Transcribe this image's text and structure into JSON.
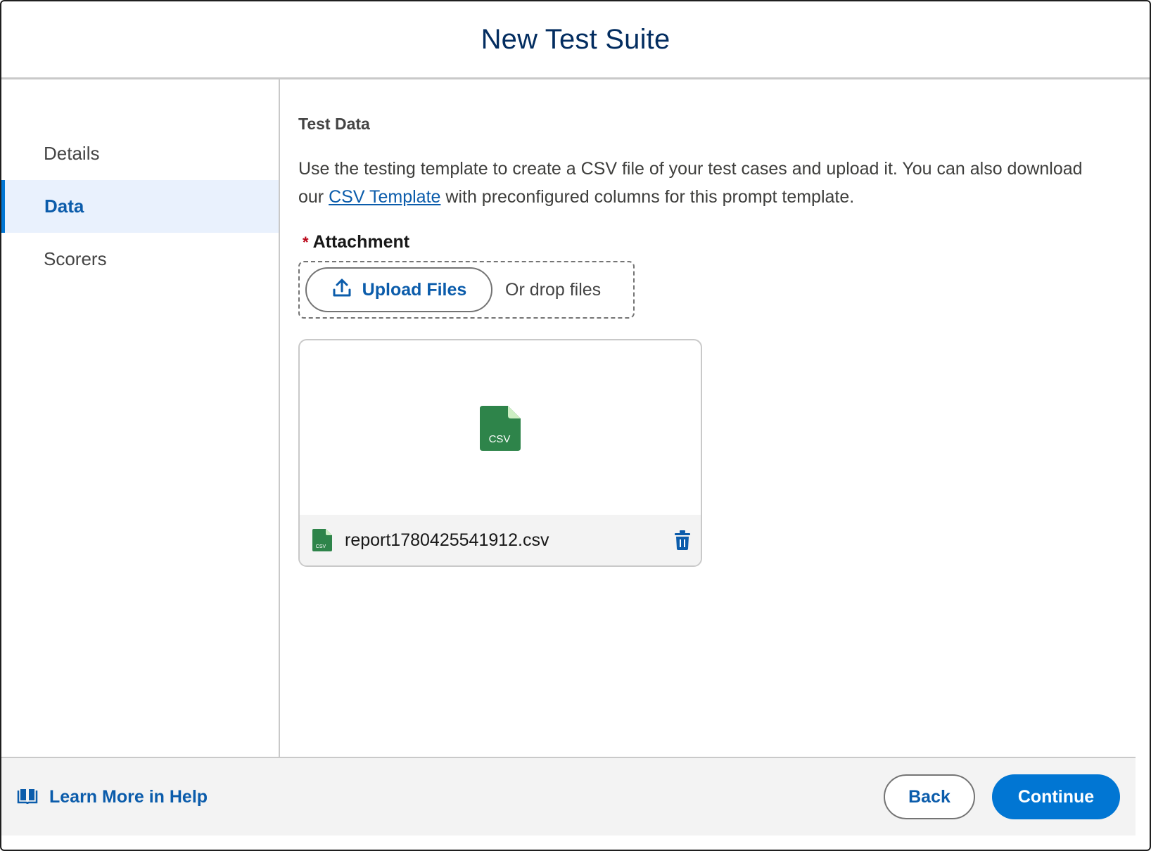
{
  "modal": {
    "title": "New Test Suite"
  },
  "sidebar": {
    "items": [
      {
        "label": "Details",
        "active": false
      },
      {
        "label": "Data",
        "active": true
      },
      {
        "label": "Scorers",
        "active": false
      }
    ]
  },
  "main": {
    "section_title": "Test Data",
    "description_before": "Use the testing template to create a CSV file of your test cases and upload it. You can also download our ",
    "description_link": "CSV Template",
    "description_after": " with preconfigured columns for this prompt template.",
    "attachment": {
      "required_marker": "*",
      "label": "Attachment",
      "upload_button": "Upload Files",
      "drop_text": "Or drop files",
      "upload_icon": "upload-icon"
    },
    "file": {
      "preview_type_label": "CSV",
      "small_type_label": "CSV",
      "name": "report1780425541912.csv",
      "icon": "csv-file-icon",
      "delete_icon": "trash-icon"
    }
  },
  "footer": {
    "help_label": "Learn More in Help",
    "help_icon": "book-icon",
    "back_label": "Back",
    "continue_label": "Continue"
  },
  "colors": {
    "brand": "#0176d3",
    "link": "#0b5cab",
    "title": "#032d60",
    "csv_green": "#2e844a",
    "required": "#ba0517"
  }
}
